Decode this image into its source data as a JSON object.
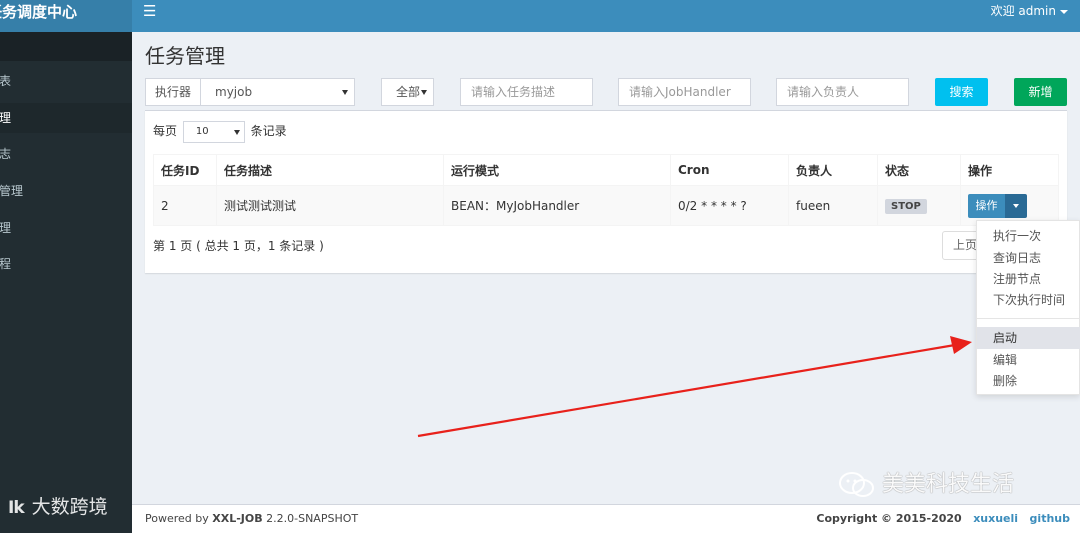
{
  "app": {
    "brand": "任务调度中心",
    "user_menu": "欢迎 admin"
  },
  "sidebar": {
    "items": [
      {
        "label": "报表"
      },
      {
        "label": "管理"
      },
      {
        "label": "日志"
      },
      {
        "label": "器管理"
      },
      {
        "label": "管理"
      },
      {
        "label": "教程"
      }
    ]
  },
  "page": {
    "title": "任务管理"
  },
  "filters": {
    "executor_label": "执行器",
    "executor_value": "myjob",
    "status_value": "全部",
    "desc_placeholder": "请输入任务描述",
    "handler_placeholder": "请输入JobHandler",
    "author_placeholder": "请输入负责人",
    "search_label": "搜索",
    "add_label": "新增"
  },
  "table": {
    "page_len_prefix": "每页",
    "page_len_value": "10",
    "page_len_suffix": "条记录",
    "headers": [
      "任务ID",
      "任务描述",
      "运行模式",
      "Cron",
      "负责人",
      "状态",
      "操作"
    ],
    "rows": [
      {
        "id": "2",
        "desc": "测试测试测试",
        "mode": "BEAN：MyJobHandler",
        "cron": "0/2 * * * * ?",
        "author": "fueen",
        "status": "STOP",
        "op_label": "操作"
      }
    ],
    "info": "第 1 页 ( 总共 1 页，1 条记录 )",
    "prev_label": "上页"
  },
  "dropdown": {
    "items": [
      "执行一次",
      "查询日志",
      "注册节点",
      "下次执行时间",
      "启动",
      "编辑",
      "删除"
    ]
  },
  "footer": {
    "powered_prefix": "Powered by ",
    "product": "XXL-JOB",
    "version": " 2.2.0-SNAPSHOT",
    "copyright": "Copyright © 2015-2020",
    "link1": "xuxueli",
    "link2": "github"
  },
  "watermarks": {
    "left_logo": "Ik",
    "left_text": "大数跨境",
    "right_text": "美美科技生活"
  },
  "colors": {
    "header": "#3c8dbc",
    "sidebar": "#222d32",
    "search": "#00c0ef",
    "add": "#00a65a",
    "annotation_arrow": "#e8211b"
  }
}
